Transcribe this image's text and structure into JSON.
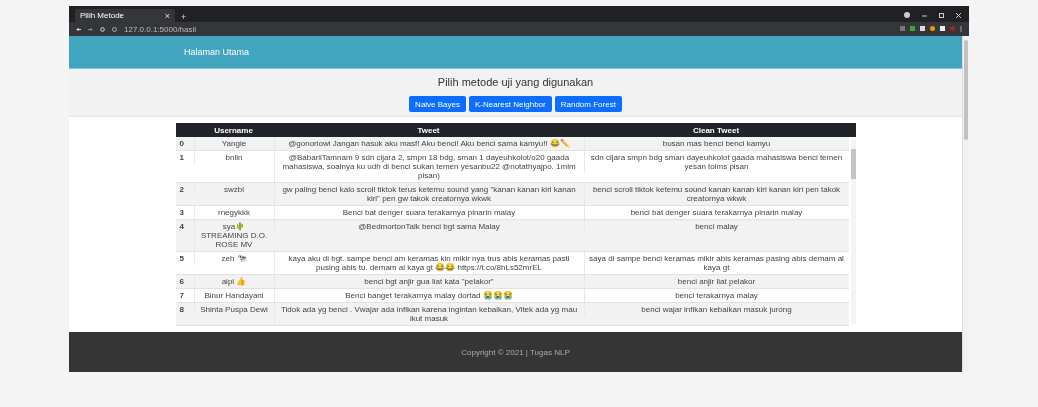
{
  "browser": {
    "tab_title": "Pilih Metode",
    "tab_close": "×",
    "new_tab": "+",
    "url": "127.0.0.1:5000/hasil"
  },
  "navbar": {
    "brand": "Halaman Utama"
  },
  "method_section": {
    "heading": "Pilih metode uji yang digunakan",
    "buttons": [
      "Naive Bayes",
      "K-Nearest Neighbor",
      "Random Forest"
    ]
  },
  "table": {
    "columns": [
      "",
      "Username",
      "Tweet",
      "Clean Tweet"
    ],
    "rows": [
      {
        "index": "0",
        "username": "Yangie",
        "tweet": "@gonoriowi Jangan hasuk aku masf! Aku benci! Aku benci sama kamyu!! 😂✏️",
        "clean_tweet": "busan mas benci benci kamyu"
      },
      {
        "index": "1",
        "username": "bnlin",
        "tweet": "@BabariiTamnam 9 sdn cijara 2, smpn 18 bdg, sman 1 dayeuhkolot/o20 gaada mahasiswa, soalnya ku udh di benci sukan temen yesanbu22 @notathyajpo. 1mlm pisan)",
        "clean_tweet": "sdn cijara smpn bdg sman dayeuhkolot gaada mahasiswa benci temen yesan tolms pisan"
      },
      {
        "index": "2",
        "username": "swzbl",
        "tweet": "gw paling benci kalo scroll tiktok terus ketemu sound yang \"kanan kanan kiri kanan kiri\" pen gw takok creatornya wkwk",
        "clean_tweet": "benci scroll tiktok ketemu sound kanan kanan kiri kanan kiri pen takok creatornya wkwk"
      },
      {
        "index": "3",
        "username": "rnegykkk",
        "tweet": "Benci bat denger suara terakarnya pinarin malay",
        "clean_tweet": "benci bat denger suara terakarnya pinarin malay"
      },
      {
        "index": "4",
        "username": "sya🌵 STREAMING D.O. ROSE MV",
        "tweet": "@BedmortonTalk benci bgt sama Malay",
        "clean_tweet": "benci malay"
      },
      {
        "index": "5",
        "username": "zeh 🐄",
        "tweet": "kaya aku di bgt. sampe benci am keramas kin mikir nya trus abis keramas pasti pusing abis tu. demam al kaya gt 😂😂 https://t.co/8hLs52mrEL",
        "clean_tweet": "saya di sampe benci keramas mikir abis keramas pasing abis demam al kaya gt"
      },
      {
        "index": "6",
        "username": "aipl 👍",
        "tweet": "benci bgt anjir gua liat kata \"pelakor\"",
        "clean_tweet": "benci anjir liat pelakor"
      },
      {
        "index": "7",
        "username": "Binur Handayani",
        "tweet": "Benci banget terakarnya malay dortad 😭😭😭",
        "clean_tweet": "benci terakarnya malay"
      },
      {
        "index": "8",
        "username": "Shinta Puspa Dewi",
        "tweet": "Tidok ada yg benci . Vwajar ada infikan karena ingintan kebaikan, Vitek ada yg mau ikut masuk",
        "clean_tweet": "benci wajar infikan kebaikan masuk jurong"
      }
    ]
  },
  "footer": {
    "text": "Copyright © 2021 | Tugas NLP"
  }
}
